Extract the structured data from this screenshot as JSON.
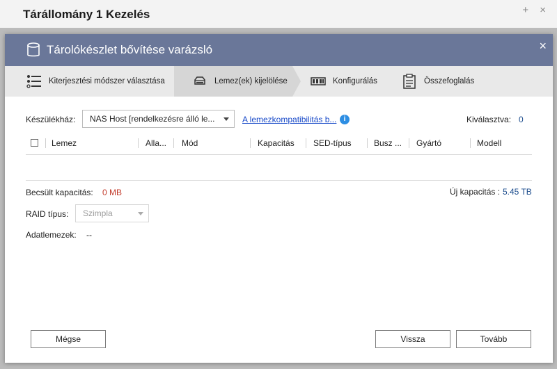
{
  "background_window": {
    "title": "Tárállomány 1 Kezelés",
    "controls": "+ ×"
  },
  "dialog": {
    "title": "Tárolókészlet bővítése varázsló",
    "close": "×"
  },
  "steps": [
    {
      "label": "Kiterjesztési módszer választása",
      "icon": "list-icon",
      "active": false
    },
    {
      "label": "Lemez(ek) kijelölése",
      "icon": "disk-icon",
      "active": true
    },
    {
      "label": "Konfigurálás",
      "icon": "raid-icon",
      "active": false
    },
    {
      "label": "Összefoglalás",
      "icon": "clipboard-icon",
      "active": false
    }
  ],
  "enclosure": {
    "label": "Készülékház:",
    "value": "NAS Host [rendelkezésre álló le...",
    "compat_link": "A lemezkompatibilitás b...",
    "info": "i",
    "selected_label": "Kiválasztva:",
    "selected_value": "0"
  },
  "table": {
    "columns": [
      "Lemez",
      "Alla...",
      "Mód",
      "Kapacitás",
      "SED-típus",
      "Busz ...",
      "Gyártó",
      "Modell"
    ]
  },
  "capacity": {
    "estimated_label": "Becsült kapacitás:",
    "estimated_value": "0 MB",
    "new_label": "Új kapacitás :",
    "new_value": "5.45 TB"
  },
  "raid": {
    "label": "RAID típus:",
    "value": "Szimpla"
  },
  "data_disks": {
    "label": "Adatlemezek:",
    "value": "--"
  },
  "buttons": {
    "cancel": "Mégse",
    "back": "Vissza",
    "next": "Tovább"
  }
}
